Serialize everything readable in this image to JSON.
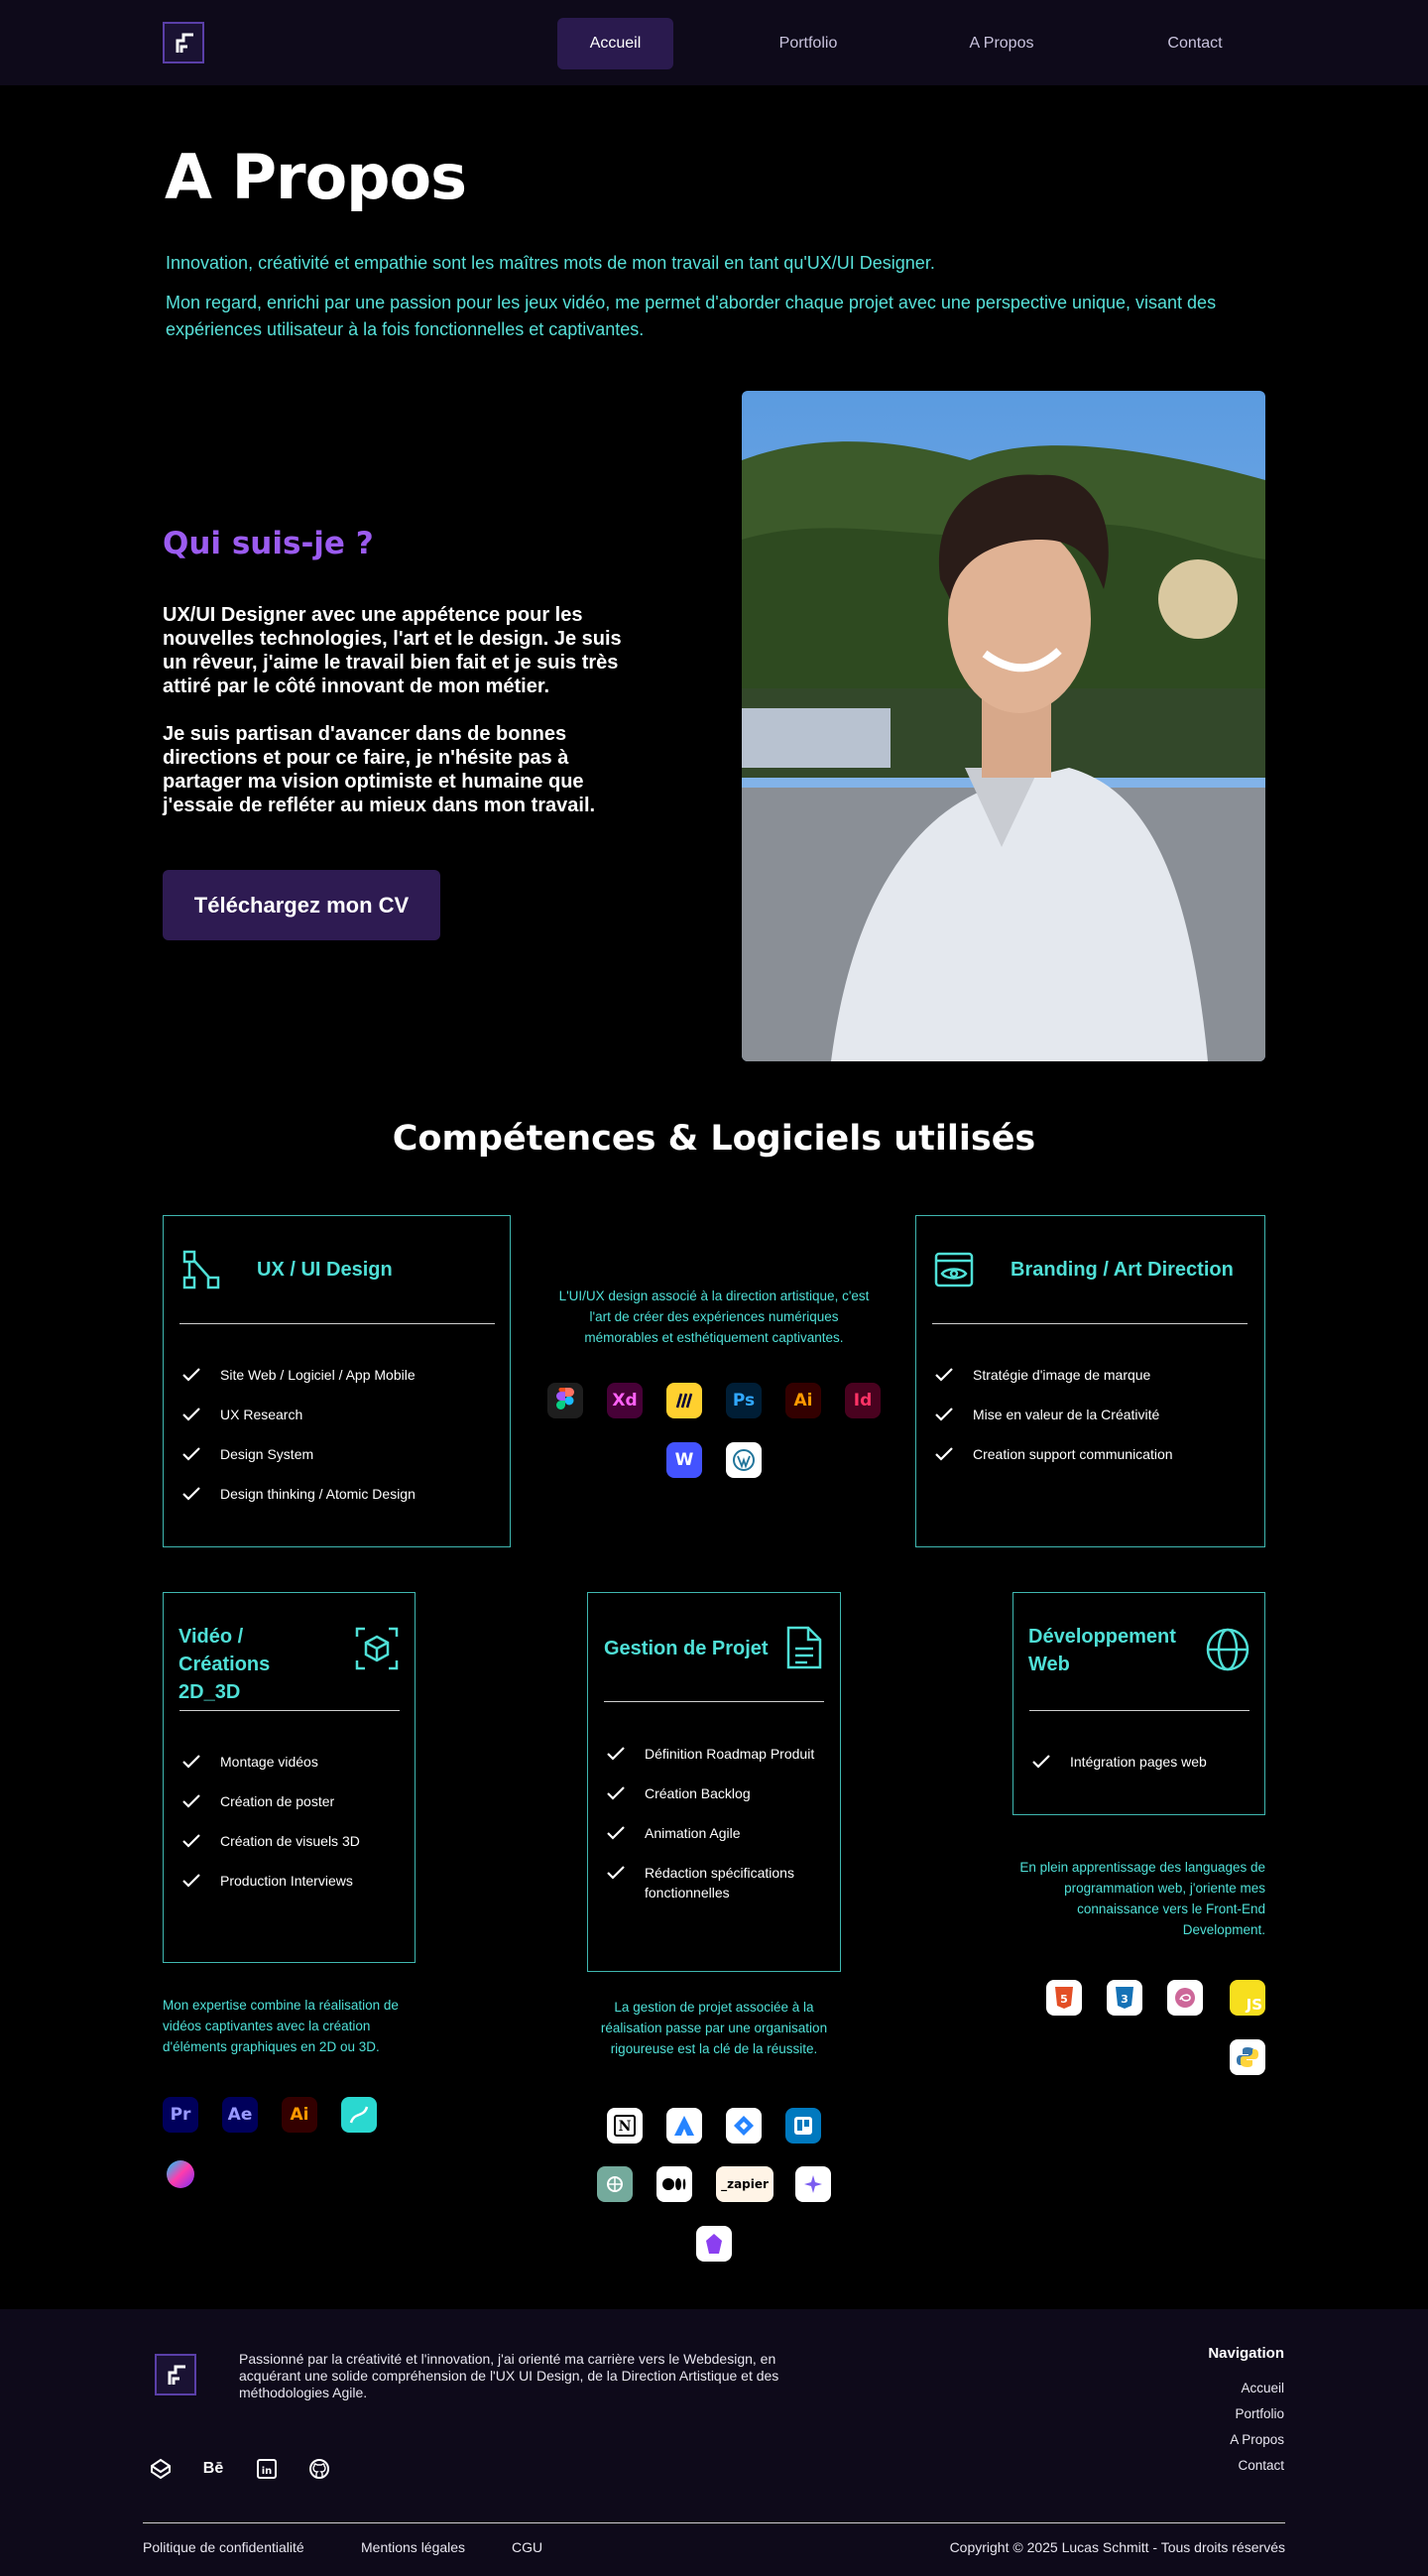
{
  "nav": {
    "items": [
      {
        "label": "Accueil"
      },
      {
        "label": "Portfolio"
      },
      {
        "label": "A Propos"
      },
      {
        "label": "Contact"
      }
    ]
  },
  "hero": {
    "title": "A Propos",
    "intro_1": "Innovation, créativité et empathie sont les maîtres mots de mon travail  en tant qu'UX/UI Designer.",
    "intro_2": "Mon regard, enrichi par une passion pour les  jeux vidéo, me permet d'aborder chaque projet avec une perspective unique, visant des expériences utilisateur à la fois fonctionnelles et  captivantes."
  },
  "about": {
    "title": "Qui suis-je ?",
    "p1": "UX/UI Designer avec une appétence pour les nouvelles technologies, l'art et le design. Je suis un rêveur, j'aime le travail bien fait et je suis très attiré par le côté innovant de mon métier.",
    "p2": "Je suis partisan d'avancer dans de bonnes directions et pour ce faire, je n'hésite pas à partager ma vision optimiste et humaine que j'essaie de refléter au mieux dans mon travail.",
    "cv_button": "Téléchargez mon CV"
  },
  "skills": {
    "title": "Compétences & Logiciels utilisés",
    "ux": {
      "title": "UX / UI Design",
      "items": [
        "Site Web / Logiciel / App Mobile",
        "UX Research",
        "Design System",
        "Design thinking / Atomic Design"
      ]
    },
    "ux_desc": "L'UI/UX design associé à la direction artistique, c'est l'art de créer des expériences numériques mémorables et esthétiquement captivantes.",
    "ux_tools": [
      "Xd",
      "Ps",
      "Ai",
      "Id",
      "W"
    ],
    "branding": {
      "title": "Branding / Art Direction",
      "items": [
        "Stratégie d'image de marque",
        "Mise en valeur de la Créativité",
        "Creation support communication"
      ]
    },
    "video": {
      "title": "Vidéo / Créations 2D_3D",
      "items": [
        "Montage vidéos",
        "Création de poster",
        "Création de visuels 3D",
        "Production Interviews"
      ],
      "desc": "Mon expertise combine la réalisation de vidéos captivantes avec la création d'éléments graphiques en 2D ou 3D.",
      "tools": [
        "Pr",
        "Ae",
        "Ai"
      ]
    },
    "project": {
      "title": "Gestion de Projet",
      "items": [
        "Définition Roadmap Produit",
        "Création Backlog",
        "Animation Agile",
        "Rédaction spécifications fonctionnelles"
      ],
      "desc": "La gestion de projet associée à la réalisation passe par une organisation rigoureuse est la clé de la réussite.",
      "tools": [
        "N",
        "_zapier"
      ]
    },
    "dev": {
      "title": "Développement Web",
      "items": [
        "Intégration pages web"
      ],
      "desc": "En plein apprentissage des languages de programmation web, j'oriente mes connaissance vers le Front-End Development.",
      "tools": [
        "5",
        "3",
        "JS"
      ]
    }
  },
  "footer": {
    "about": "Passionné par la créativité et l'innovation, j'ai orienté ma carrière vers le Webdesign, en acquérant une solide compréhension de l'UX UI Design, de la Direction Artistique et des méthodologies Agile.",
    "nav_title": "Navigation",
    "nav": [
      "Accueil",
      "Portfolio",
      "A Propos",
      "Contact"
    ],
    "social": [
      "Bē",
      "in"
    ],
    "links": [
      "Politique de confidentialité",
      "Mentions légales",
      "CGU"
    ],
    "copyright": "Copyright © 2025 Lucas Schmitt - Tous droits réservés"
  },
  "colors": {
    "accent_teal": "#4fe0d7",
    "accent_purple": "#9b5bf0",
    "nav_active": "#2a1a4e"
  }
}
